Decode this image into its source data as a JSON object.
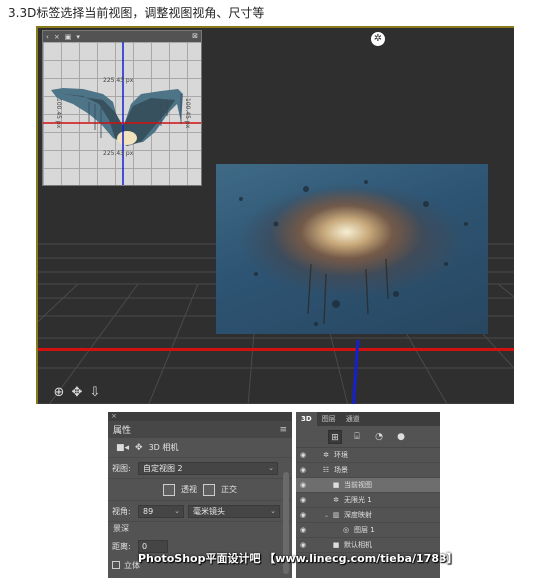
{
  "caption": "3.3D标签选择当前视图，调整视图视角、尺寸等",
  "viewport": {
    "nav_icons": [
      "orbit-icon",
      "pan-icon",
      "walk-icon"
    ],
    "light_icon": "sun-icon"
  },
  "mini_view": {
    "bar_items": [
      "‹",
      "×",
      "▣",
      "▾"
    ],
    "expand": "⊠",
    "dims": {
      "top": "225.43 px",
      "bottom": "225.43 px",
      "left": "100.45 px",
      "right": "100.45 px"
    }
  },
  "properties": {
    "topbar": "×",
    "title": "属性",
    "menu": "≡",
    "camera_label": "3D 相机",
    "view_label": "视图:",
    "view_value": "自定视图 2",
    "perspective_label": "透视",
    "ortho_label": "正交",
    "angle_label": "视角:",
    "angle_value": "89",
    "lens_value": "毫米镜头",
    "depth_label": "景深",
    "distance_label": "距离:",
    "distance_value": "0",
    "stereo_label": "立体"
  },
  "layers_panel": {
    "tabs": [
      "3D",
      "图层",
      "通道"
    ],
    "active_tab": "3D",
    "rows": [
      {
        "label": "环境",
        "icon": "✲",
        "indent": 1,
        "arrow": "",
        "selected": false
      },
      {
        "label": "场景",
        "icon": "☷",
        "indent": 1,
        "arrow": "",
        "selected": false
      },
      {
        "label": "当前视图",
        "icon": "■",
        "indent": 2,
        "arrow": "",
        "selected": true
      },
      {
        "label": "无限光 1",
        "icon": "✲",
        "indent": 2,
        "arrow": "",
        "selected": false
      },
      {
        "label": "深度映射",
        "icon": "▥",
        "indent": 2,
        "arrow": "⌄",
        "selected": false
      },
      {
        "label": "图层 1",
        "icon": "◎",
        "indent": 3,
        "arrow": "",
        "selected": false
      },
      {
        "label": "默认相机",
        "icon": "■",
        "indent": 2,
        "arrow": "",
        "selected": false
      }
    ]
  },
  "watermark": "PhotoShop平面设计吧 【www.linecg.com/tieba/1783】"
}
